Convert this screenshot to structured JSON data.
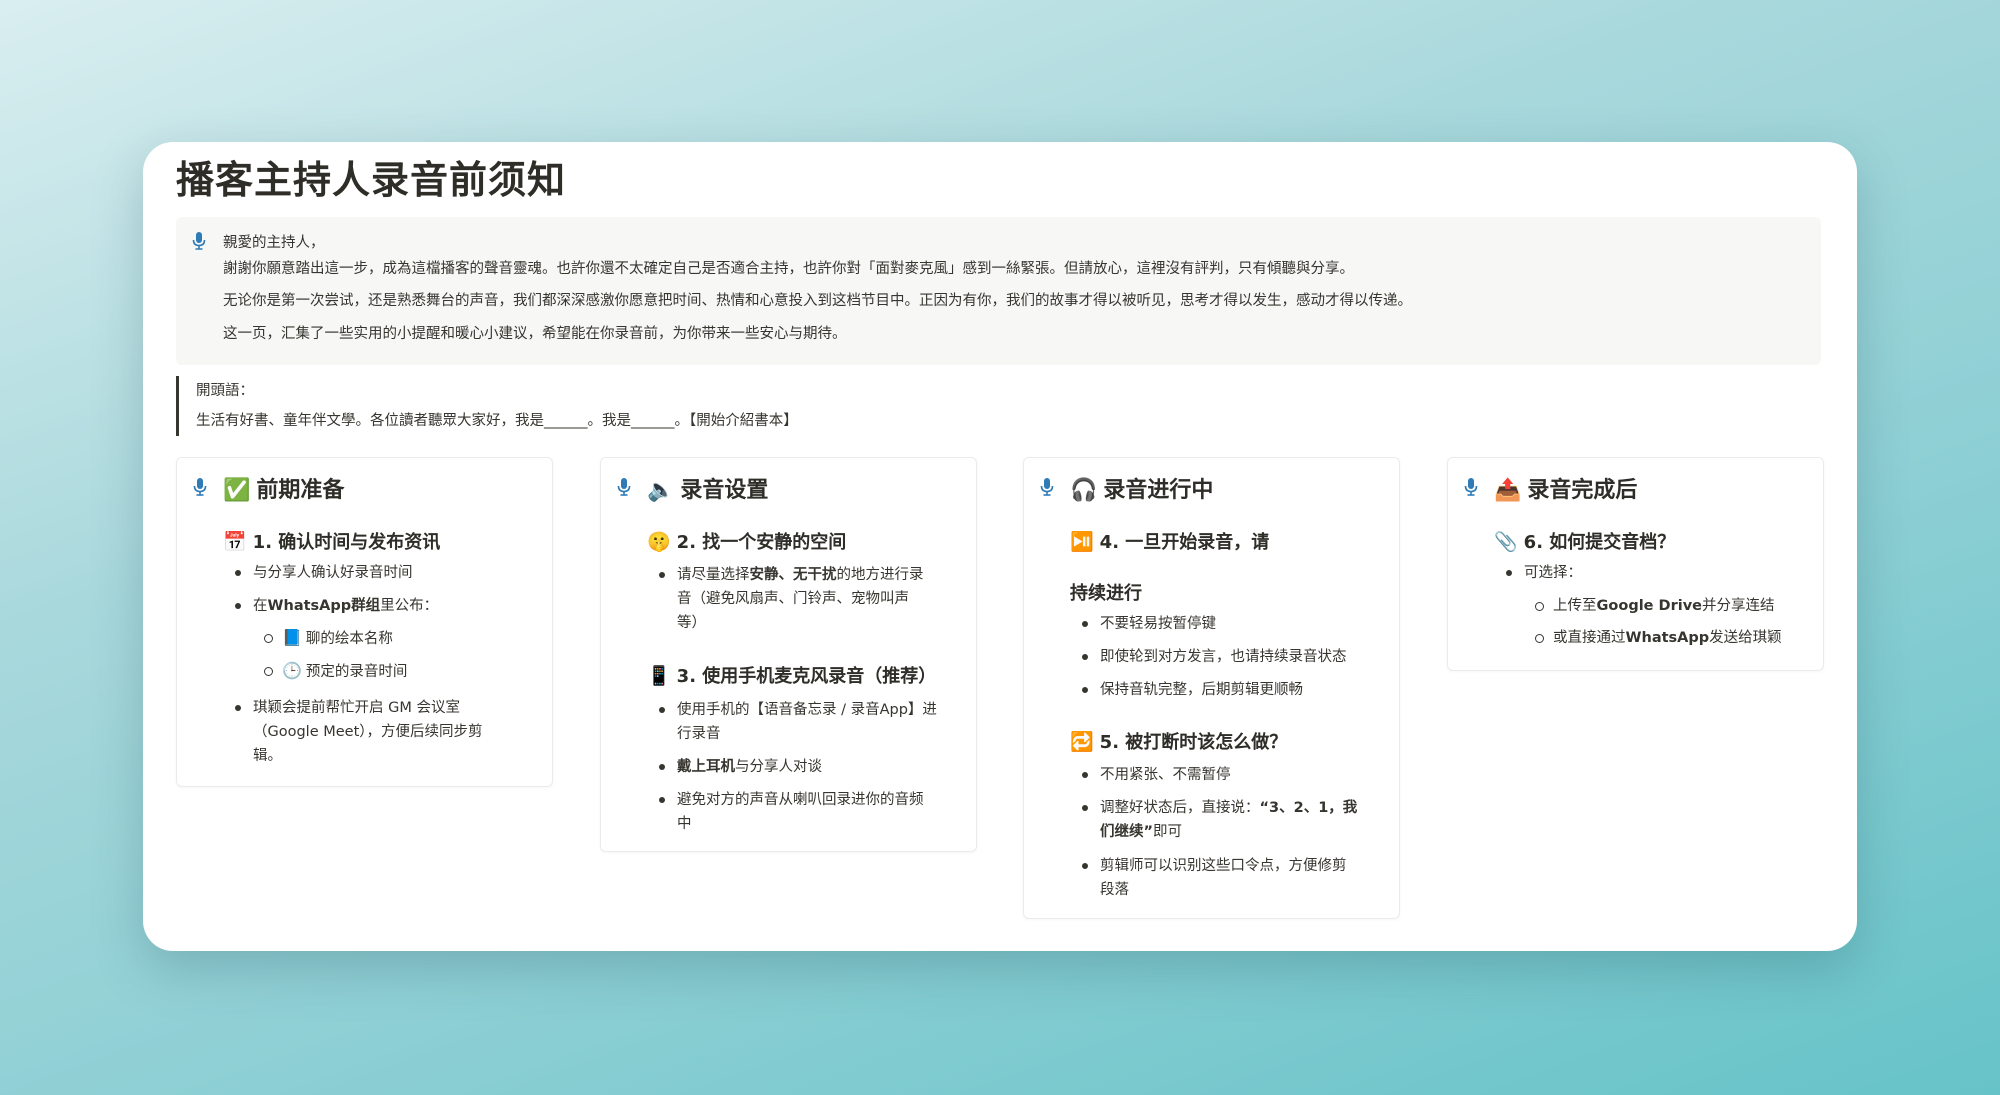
{
  "page": {
    "title": "播客主持人录音前须知"
  },
  "callout": {
    "line1": "親愛的主持人，",
    "line2": "謝謝你願意踏出這一步，成為這檔播客的聲音靈魂。也許你還不太確定自己是否適合主持，也許你對「面對麥克風」感到一絲緊張。但請放心，這裡沒有評判，只有傾聽與分享。",
    "line3": "无论你是第一次尝试，还是熟悉舞台的声音，我们都深深感激你愿意把时间、热情和心意投入到这档节目中。正因为有你，我们的故事才得以被听见，思考才得以发生，感动才得以传递。",
    "line4": "这一页，汇集了一些实用的小提醒和暖心小建议，希望能在你录音前，为你带来一些安心与期待。"
  },
  "quote": {
    "line1": "開頭語：",
    "line2": "生活有好書、童年伴文學。各位讀者聽眾大家好，我是______。我是______。【開始介紹書本】"
  },
  "cards": [
    {
      "emoji": "✅",
      "title": "前期准备",
      "sub1_emoji": "📅",
      "sub1": "1. 确认时间与发布资讯",
      "b1": "与分享人确认好录音时间",
      "b2_pre": "在",
      "b2_bold": "WhatsApp群组",
      "b2_post": "里公布：",
      "b2a_emoji": "📘",
      "b2a": "聊的绘本名称",
      "b2b_emoji": "🕒",
      "b2b": "预定的录音时间",
      "b3_line1": "琪颖会提前帮忙开启 GM 会议室",
      "b3_line2": "（Google Meet），方便后续同步剪",
      "b3_line3": "辑。"
    },
    {
      "emoji": "🔈",
      "title": "录音设置",
      "sub1_emoji": "🤫",
      "sub1": "2. 找一个安静的空间",
      "b1_pre": "请尽量选择",
      "b1_bold": "安静、无干扰",
      "b1_post": "的地方进行录",
      "b1_line2": "音（避免风扇声、门铃声、宠物叫声",
      "b1_line3": "等）",
      "sub2_emoji": "📱",
      "sub2": "3. 使用手机麦克风录音（推荐）",
      "b2_line1": "使用手机的【语音备忘录 / 录音App】进",
      "b2_line2": "行录音",
      "b3_bold": "戴上耳机",
      "b3_post": "与分享人对谈",
      "b4_line1": "避免对方的声音从喇叭回录进你的音频",
      "b4_line2": "中"
    },
    {
      "emoji": "🎧",
      "title": "录音进行中",
      "sub1_emoji": "⏯️",
      "sub1": "4. 一旦开始录音，请",
      "sub1b": "持续进行",
      "b1": "不要轻易按暂停键",
      "b2": "即使轮到对方发言，也请持续录音状态",
      "b3": "保持音轨完整，后期剪辑更顺畅",
      "sub2_emoji": "🔁",
      "sub2": "5. 被打断时该怎么做？",
      "b4": "不用紧张、不需暂停",
      "b5_pre": "调整好状态后，直接说：",
      "b5_bold": "“3、2、1，我",
      "b5_line2_bold": "们继续”",
      "b5_line2_post": "即可",
      "b6_line1": "剪辑师可以识别这些口令点，方便修剪",
      "b6_line2": "段落"
    },
    {
      "emoji": "📤",
      "title": "录音完成后",
      "sub1_emoji": "📎",
      "sub1": "6. 如何提交音档？",
      "b1": "可选择：",
      "b1a_pre": "上传至",
      "b1a_bold": "Google Drive",
      "b1a_post": "并分享连结",
      "b1b_pre": "或直接通过",
      "b1b_bold": "WhatsApp",
      "b1b_post": "发送给琪颖"
    }
  ],
  "icons": {
    "callout_icon": "microphone-icon",
    "card_icon": "microphone-icon",
    "mic_color": "#2e7bb6"
  }
}
